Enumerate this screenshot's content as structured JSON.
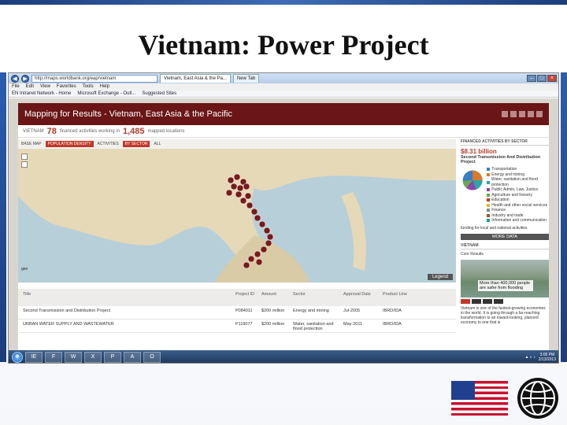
{
  "slide": {
    "title": "Vietnam: Power Project"
  },
  "browser": {
    "url": "http://maps.worldbank.org/eap/vietnam",
    "tabs": [
      "Vietnam, East Asia & the Pa...",
      "New Tab"
    ],
    "menu": [
      "File",
      "Edit",
      "View",
      "Favorites",
      "Tools",
      "Help"
    ],
    "favorites": [
      "EN Intranet Network - Home",
      "Microsoft Exchange - Outl...",
      "Suggested Sites"
    ]
  },
  "site": {
    "header_title": "Mapping for Results - Vietnam, East Asia & the Pacific",
    "stats": {
      "view_label": "VIETNAM",
      "activities_count": "78",
      "activities_text": "financed activities working in",
      "locations_count": "1,485",
      "locations_text": "mapped locations"
    },
    "controls": {
      "base_map_label": "BASE MAP",
      "base_map_value": "POPULATION DENSITY",
      "activities_label": "ACTIVITIES",
      "activities_value": "BY SECTOR",
      "all_label": "ALL"
    },
    "map": {
      "legend_label": "Legend",
      "logo_label": "geo"
    },
    "table": {
      "headers": [
        "Title",
        "Project ID",
        "Amount",
        "Sector",
        "Approval Date",
        "Product Line"
      ],
      "rows": [
        [
          "Second Transmission and Distribution Project",
          "P084011",
          "$200 million",
          "Energy and mining",
          "Jul-2005",
          "IBRD/IDA"
        ],
        [
          "URBAN WATER SUPPLY AND WASTEWATER",
          "P119077",
          "$200 million",
          "Water, sanitation and flood protection",
          "May-2011",
          "IBRD/IDA"
        ]
      ]
    },
    "panel": {
      "heading": "FINANCED ACTIVITIES BY SECTOR",
      "amount": "$8.31 billion",
      "project_name": "Second Transmission And Distribution Project",
      "sectors": [
        {
          "name": "Transportation",
          "color": "#3b7dc4"
        },
        {
          "name": "Energy and mining",
          "color": "#d97a2b"
        },
        {
          "name": "Water, sanitation and flood protection",
          "color": "#2aa6a6"
        },
        {
          "name": "Public Admin, Law, Justice",
          "color": "#8e44ad"
        },
        {
          "name": "Agriculture and forestry",
          "color": "#6aa84f"
        },
        {
          "name": "Education",
          "color": "#c0392b"
        },
        {
          "name": "Health and other social services",
          "color": "#e6b422"
        },
        {
          "name": "Finance",
          "color": "#7f8c8d"
        },
        {
          "name": "Industry and trade",
          "color": "#a0522d"
        },
        {
          "name": "Information and communication",
          "color": "#16a085"
        }
      ],
      "note": "funding for local and national activities",
      "more_button": "MORE DATA",
      "country_heading": "VIETNAM",
      "country_sub": "Core Results",
      "photo_caption": "More than 400,000 people are safer from flooding",
      "blurb": "Vietnam is one of the fastest-growing economies in the world. It is going through a far-reaching transformation to an inward-looking, planned economy to one that is"
    }
  },
  "taskbar": {
    "apps": [
      "IE",
      "F",
      "W",
      "X",
      "P",
      "A",
      "O"
    ],
    "time": "3:05 PM",
    "date": "2/13/2013"
  },
  "branding": {
    "flag_label": "United States flag",
    "logo_label": "World Bank logo"
  }
}
